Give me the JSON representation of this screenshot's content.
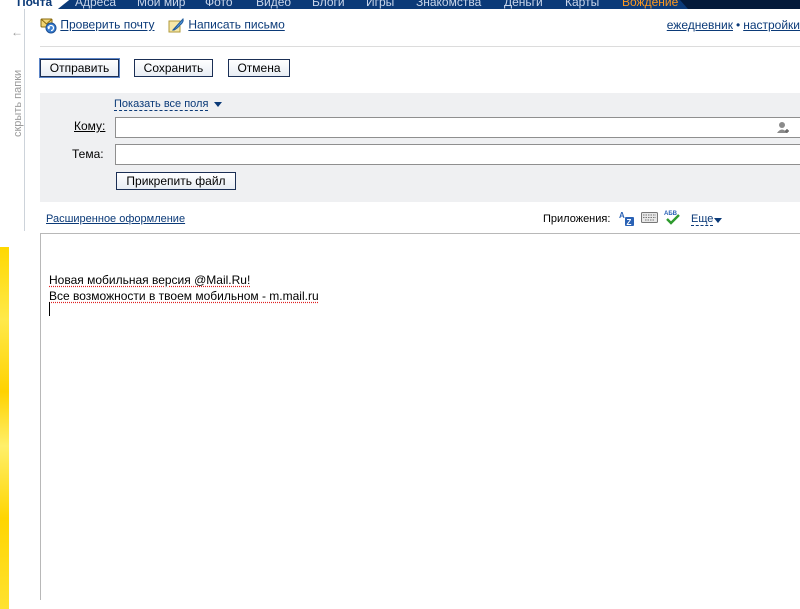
{
  "topnav": {
    "tabs": [
      {
        "label": "Почта",
        "active": true
      },
      {
        "label": "Адреса"
      },
      {
        "label": "Мой мир"
      },
      {
        "label": "Фото"
      },
      {
        "label": "Видео"
      },
      {
        "label": "Блоги"
      },
      {
        "label": "Игры"
      },
      {
        "label": "Знакомства"
      },
      {
        "label": "Деньги"
      },
      {
        "label": "Карты"
      },
      {
        "label": "Вождение",
        "accent": "#ff9a1f"
      }
    ],
    "background": "#0b3a78"
  },
  "sidebar": {
    "hide_folders_label": "скрыть папки",
    "hide_folders_icon": "arrow-left-icon"
  },
  "toolbar": {
    "check_mail": "Проверить почту",
    "check_mail_icon": "refresh-mail-icon",
    "write_mail": "Написать письмо",
    "write_mail_icon": "feather-pen-icon",
    "diary": "ежедневник",
    "settings": "настройки",
    "separator": "•"
  },
  "actions": {
    "send": "Отправить",
    "save": "Сохранить",
    "cancel": "Отмена"
  },
  "fields": {
    "show_all": "Показать все поля",
    "to_label": "Кому:",
    "to_value": "",
    "subject_label": "Тема:",
    "subject_value": "",
    "attach": "Прикрепить файл",
    "contacts_icon": "address-book-icon"
  },
  "editor_toolbar": {
    "rich_format": "Расширенное оформление",
    "apps_label": "Приложения:",
    "apps": [
      "translate-icon",
      "keyboard-icon",
      "spellcheck-icon"
    ],
    "more": "Еще"
  },
  "message": {
    "lines": [
      "Новая мобильная версия @Mail.Ru!",
      "Все возможности в твоем мобильном - m.mail.ru"
    ]
  },
  "colors": {
    "link": "#0b3a78",
    "panel": "#eff0f2",
    "strip_yellow": "#ffd800"
  }
}
